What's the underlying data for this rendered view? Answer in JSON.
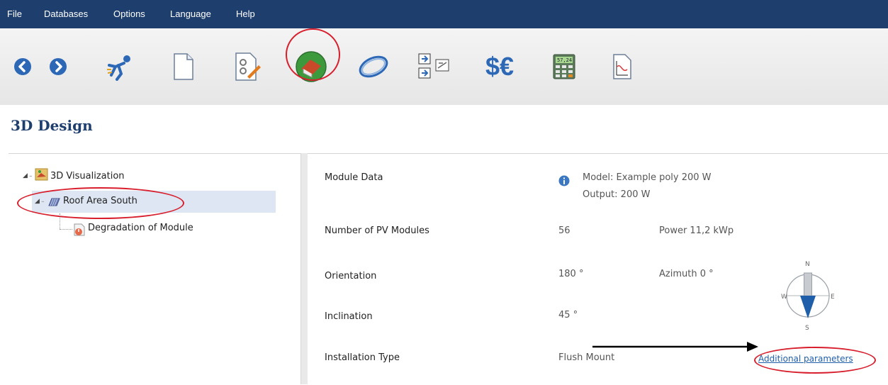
{
  "menu": [
    "File",
    "Databases",
    "Options",
    "Language",
    "Help"
  ],
  "toolbar": {
    "icons": [
      "back-arrow-icon",
      "forward-arrow-icon",
      "running-figure-icon",
      "blank-document-icon",
      "document-edit-icon",
      "3d-house-globe-icon",
      "orbit-icon",
      "flow-diagram-icon",
      "currency-icon",
      "calculator-icon",
      "chart-document-icon"
    ],
    "currency_text": "$€",
    "calculator_display": "57,24"
  },
  "page": {
    "title": "3D Design"
  },
  "tree": {
    "root": "3D Visualization",
    "child": "Roof Area South",
    "grandchild": "Degradation of Module"
  },
  "details": {
    "module_data_label": "Module Data",
    "model": "Model: Example poly 200 W",
    "output": "Output: 200 W",
    "modules_label": "Number of PV Modules",
    "modules_value": "56",
    "power": "Power 11,2 kWp",
    "orientation_label": "Orientation",
    "orientation_value": "180 °",
    "azimuth": "Azimuth 0 °",
    "inclination_label": "Inclination",
    "inclination_value": "45 °",
    "installation_label": "Installation Type",
    "installation_value": "Flush Mount",
    "additional_link": "Additional parameters"
  },
  "compass": {
    "n": "N",
    "s": "S",
    "e": "E",
    "w": "W"
  },
  "colors": {
    "menubar": "#1e3f6e",
    "annotation": "#d81e2c",
    "selection": "#dde6f2",
    "link": "#1f5ea8"
  }
}
